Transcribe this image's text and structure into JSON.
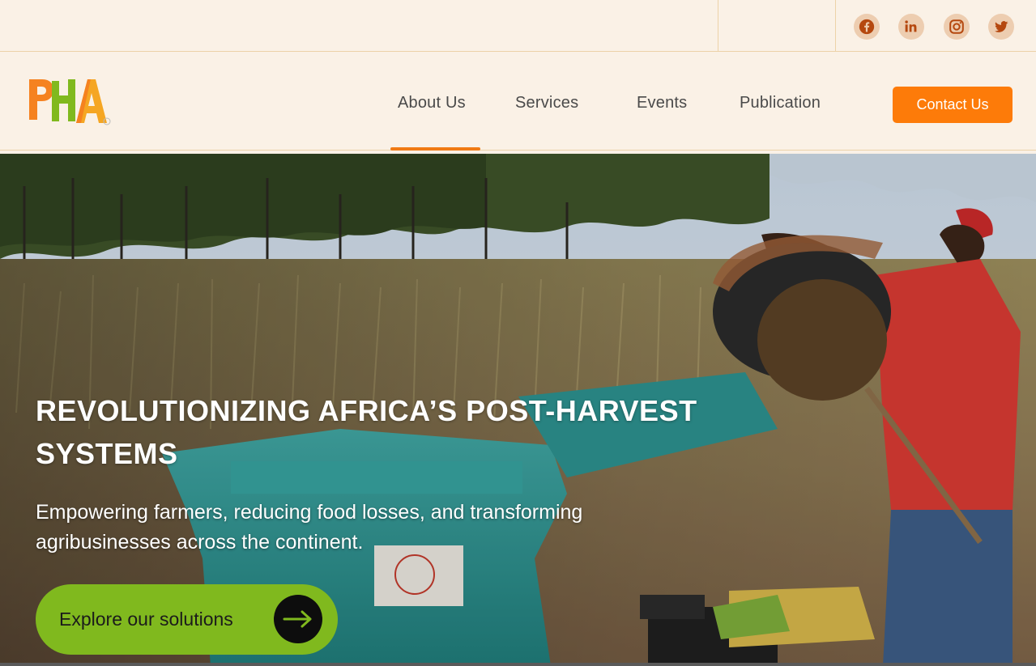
{
  "social": {
    "facebook": "facebook-icon",
    "linkedin": "linkedin-icon",
    "instagram": "instagram-icon",
    "twitter": "twitter-icon"
  },
  "logo": {
    "text": "PHA"
  },
  "nav": {
    "items": [
      {
        "label": "About Us",
        "active": true
      },
      {
        "label": "Services"
      },
      {
        "label": "Events"
      },
      {
        "label": "Publication"
      }
    ],
    "contact_label": "Contact Us"
  },
  "hero": {
    "title": "REVOLUTIONIZING AFRICA’S POST-HARVEST SYSTEMS",
    "subtitle": "Empowering farmers, reducing food losses, and transforming agribusinesses  across the continent.",
    "cta_label": "Explore our solutions"
  },
  "colors": {
    "background": "#faf1e6",
    "accent_orange": "#fd7b09",
    "social_bg": "#edcdb0",
    "social_icon": "#b5480f",
    "cta_green": "#80b91e"
  }
}
